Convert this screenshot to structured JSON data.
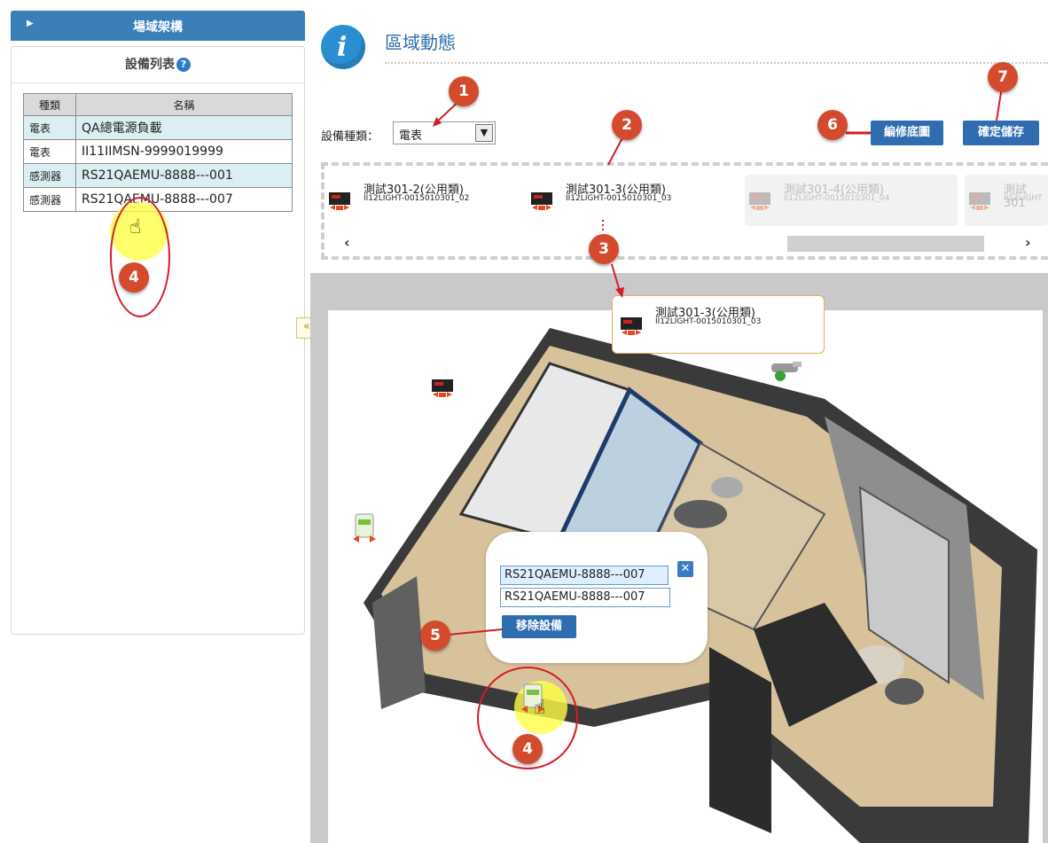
{
  "left": {
    "header": "場域架構",
    "list_title": "設備列表",
    "help_icon_glyph": "?",
    "columns": [
      "種類",
      "名稱"
    ],
    "rows": [
      {
        "type": "電表",
        "name": "QA總電源負載"
      },
      {
        "type": "電表",
        "name": "II11IIMSN-9999019999"
      },
      {
        "type": "感測器",
        "name": "RS21QAEMU-8888---001"
      },
      {
        "type": "感測器",
        "name": "RS21QAEMU-8888---007"
      }
    ]
  },
  "collapse_glyph": "«",
  "main": {
    "title": "區域動態",
    "device_type_label": "設備種類：",
    "device_type_value": "電表",
    "edit_floor_button": "編修底圖",
    "save_button": "確定儲存"
  },
  "strip": {
    "cards": [
      {
        "name": "測試301-2(公用類)",
        "id": "II12LIGHT-0015010301_02"
      },
      {
        "name": "測試301-3(公用類)",
        "id": "II12LIGHT-0015010301_03"
      },
      {
        "name": "測試301-4(公用類)",
        "id": "II12LIGHT-0015010301_04"
      },
      {
        "name": "測試301",
        "id": "II12LIGHT"
      }
    ],
    "scroll_left": "‹",
    "scroll_right": "›"
  },
  "placed_card": {
    "name": "測試301-3(公用類)",
    "id": "II12LIGHT-0015010301_03"
  },
  "popup": {
    "options": [
      "RS21QAEMU-8888---007",
      "RS21QAEMU-8888---007"
    ],
    "close_glyph": "✕",
    "remove_button": "移除設備"
  },
  "callouts": [
    "1",
    "2",
    "3",
    "4",
    "4",
    "5",
    "6",
    "7"
  ],
  "colors": {
    "accent": "#2f6db0",
    "callout": "#d44a2c",
    "ring": "#d31d2a",
    "row_highlight": "#dbeef2"
  }
}
